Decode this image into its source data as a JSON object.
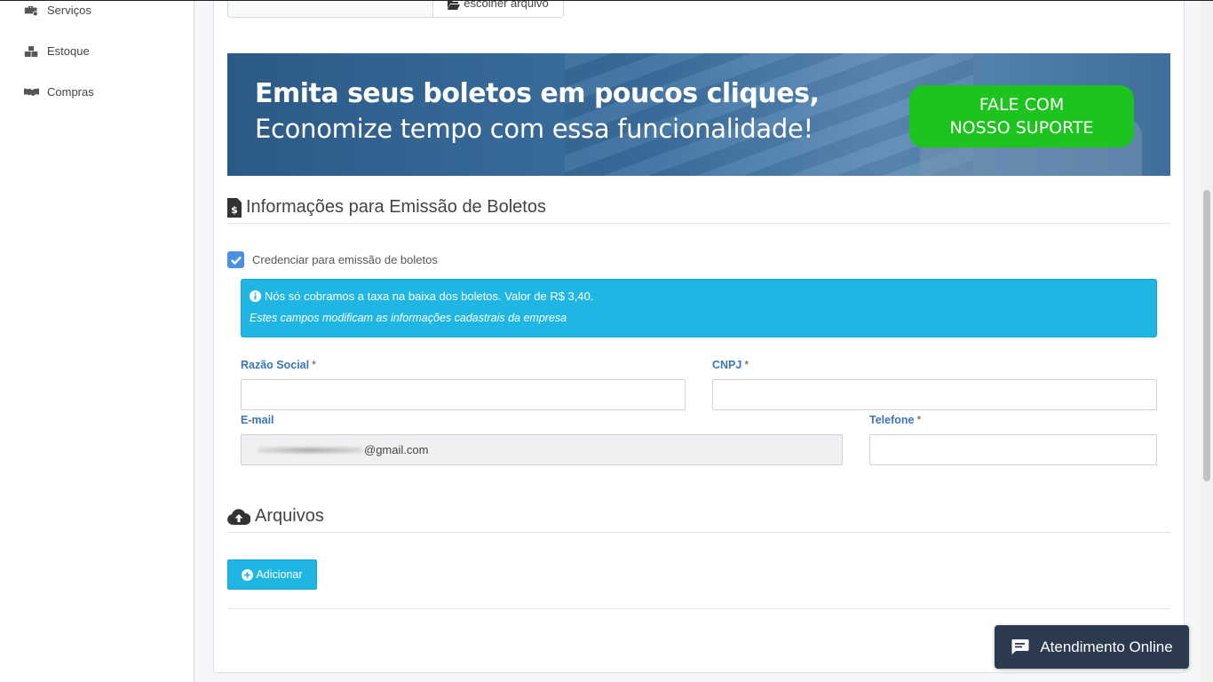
{
  "sidebar": {
    "items": [
      {
        "label": "Serviços",
        "icon": "services-icon"
      },
      {
        "label": "Estoque",
        "icon": "boxes-icon"
      },
      {
        "label": "Compras",
        "icon": "handshake-icon"
      }
    ]
  },
  "file_chooser": {
    "button_label": "escolher arquivo"
  },
  "banner": {
    "headline": "Emita seus boletos em poucos cliques,",
    "subline": "Economize tempo com essa funcionalidade!",
    "cta_line1": "FALE COM",
    "cta_line2": "NOSSO SUPORTE",
    "cta_color": "#1ec41e"
  },
  "boleto_section": {
    "title": "Informações para Emissão de Boletos",
    "checkbox_label": "Credenciar para emissão de boletos",
    "checkbox_checked": true,
    "alert_line1": "Nós só cobramos a taxa na baixa dos boletos. Valor de R$ 3,40.",
    "alert_line2": "Estes campos modificam as informações cadastrais da empresa",
    "fields": {
      "razao_social": {
        "label": "Razão Social",
        "required": "*",
        "value": ""
      },
      "cnpj": {
        "label": "CNPJ",
        "required": "*",
        "value": ""
      },
      "email": {
        "label": "E-mail",
        "value_suffix": "@gmail.com"
      },
      "telefone": {
        "label": "Telefone",
        "required": "*",
        "value": ""
      }
    }
  },
  "files_section": {
    "title": "Arquivos",
    "add_button": "Adicionar"
  },
  "chat_widget": {
    "label": "Atendimento Online"
  },
  "colors": {
    "accent": "#20b6e3",
    "label_blue": "#3b75b5",
    "checkbox": "#4a90e2",
    "chat_bg": "#2b3a4e"
  }
}
